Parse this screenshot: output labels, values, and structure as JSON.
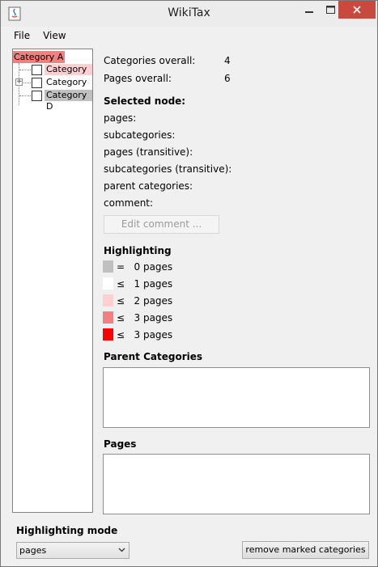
{
  "window": {
    "title": "WikiTax",
    "close_color": "#c9493f"
  },
  "menu": {
    "file": "File",
    "view": "View"
  },
  "tree": {
    "root": "Category A",
    "children": [
      {
        "label": "Category B",
        "checked": false,
        "expandable": false,
        "highlight": "#ffcfd2"
      },
      {
        "label": "Category C",
        "checked": false,
        "expandable": true,
        "highlight": "#ffffff"
      },
      {
        "label": "Category D",
        "checked": false,
        "expandable": false,
        "highlight": "#c0c0c0"
      }
    ],
    "root_highlight": "#f28080"
  },
  "stats": {
    "categories_label": "Categories overall:",
    "categories_value": "4",
    "pages_label": "Pages overall:",
    "pages_value": "6"
  },
  "selected_node": {
    "heading": "Selected node:",
    "pages": "pages:",
    "subcategories": "subcategories:",
    "pages_transitive": "pages (transitive):",
    "subcategories_transitive": "subcategories (transitive):",
    "parent_categories": "parent categories:",
    "comment": "comment:",
    "edit_comment_button": "Edit comment ..."
  },
  "highlighting": {
    "heading": "Highlighting",
    "legend": [
      {
        "color": "#c0c0c0",
        "text": "=   0 pages"
      },
      {
        "color": "#ffffff",
        "text": "≤   1 pages"
      },
      {
        "color": "#ffcfd2",
        "text": "≤   2 pages"
      },
      {
        "color": "#f28080",
        "text": "≤   3 pages"
      },
      {
        "color": "#ff0000",
        "text": "≤   3 pages"
      }
    ]
  },
  "parent_categories": {
    "heading": "Parent Categories"
  },
  "pages_section": {
    "heading": "Pages"
  },
  "bottom": {
    "mode_label": "Highlighting mode",
    "mode_value": "pages",
    "remove_button": "remove marked categories"
  }
}
